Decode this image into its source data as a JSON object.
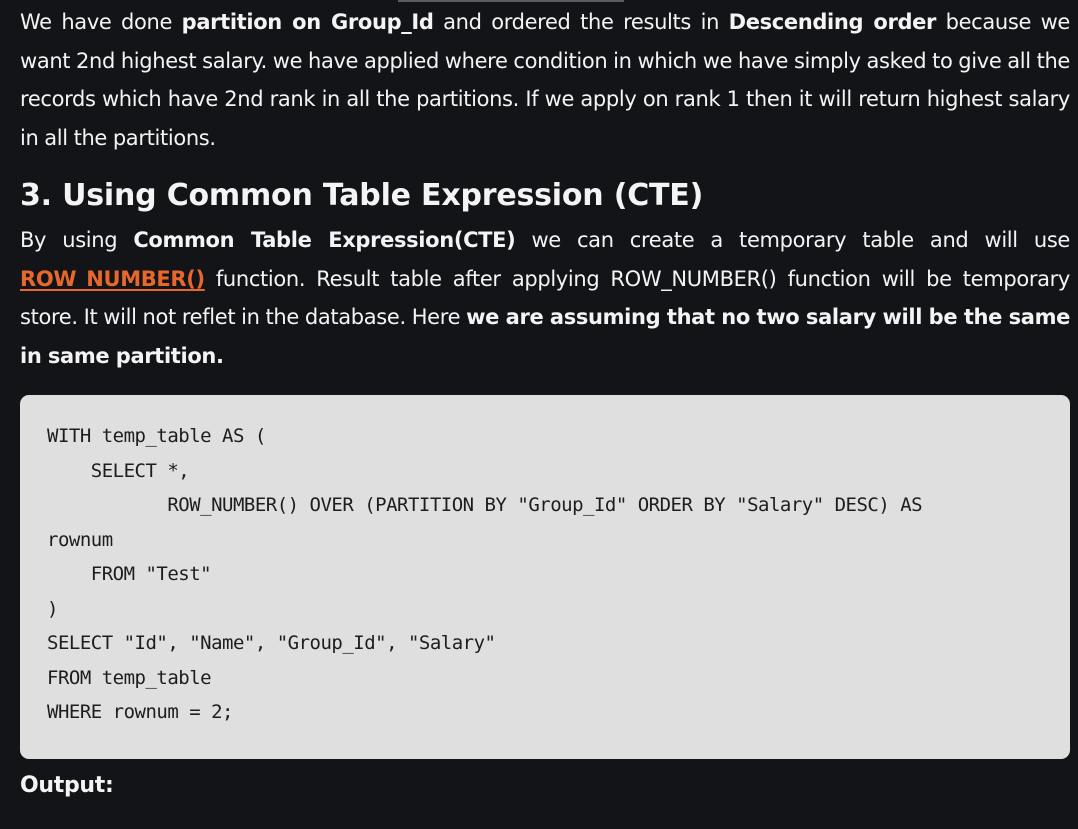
{
  "intro": {
    "s1": "We have done ",
    "s1_bold": "partition on Group_Id",
    "s2": " and ordered the results in ",
    "s2_bold": "Descending order",
    "s3": " because we want 2nd highest salary. we have applied where condition in which we have simply asked to give all the records which have 2nd rank in all the partitions. If we apply on rank 1 then it will return highest salary in all the partitions."
  },
  "section": {
    "heading": "3. Using Common Table Expression (CTE)",
    "p1": "By using ",
    "p1_bold": "Common Table Expression(CTE)",
    "p2": " we can create a temporary table and will use ",
    "link": "ROW_NUMBER()",
    "p3": " function. Result table after applying ROW_NUMBER() function will be temporary store. It will not reflet in the database. Here ",
    "p3_bold": "we are assuming that no two salary will be the same in same partition."
  },
  "code": {
    "lines": [
      "WITH temp_table AS (",
      "    SELECT *,",
      "           ROW_NUMBER() OVER (PARTITION BY \"Group_Id\" ORDER BY \"Salary\" DESC) AS",
      "rownum",
      "    FROM \"Test\"",
      ")",
      "SELECT \"Id\", \"Name\", \"Group_Id\", \"Salary\"",
      "FROM temp_table",
      "WHERE rownum = 2;"
    ]
  },
  "output": {
    "label": "Output:"
  }
}
